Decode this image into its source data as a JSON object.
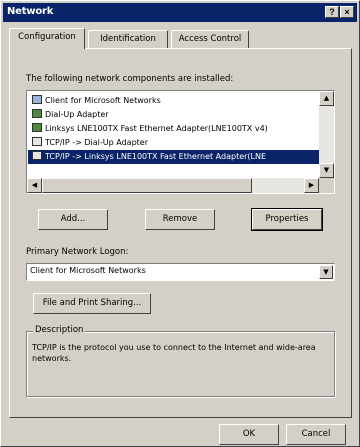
{
  "window": {
    "title": "Network",
    "help_button": "?",
    "close_button": "×"
  },
  "tabs": [
    {
      "label": "Configuration",
      "active": true
    },
    {
      "label": "Identification",
      "active": false
    },
    {
      "label": "Access Control",
      "active": false
    }
  ],
  "components": {
    "label": "The following network components are installed:",
    "items": [
      {
        "label": "Client for Microsoft Networks",
        "icon": "network-client-icon",
        "selected": false
      },
      {
        "label": "Dial-Up Adapter",
        "icon": "network-adapter-icon",
        "selected": false
      },
      {
        "label": "Linksys LNE100TX Fast Ethernet Adapter(LNE100TX v4)",
        "icon": "network-adapter-icon",
        "selected": false
      },
      {
        "label": "TCP/IP -> Dial-Up Adapter",
        "icon": "protocol-icon",
        "selected": false
      },
      {
        "label": "TCP/IP -> Linksys LNE100TX Fast Ethernet Adapter(LNE",
        "icon": "protocol-icon",
        "selected": true
      }
    ]
  },
  "buttons": {
    "add": "Add...",
    "remove": "Remove",
    "properties": "Properties",
    "file_print_sharing": "File and Print Sharing...",
    "ok": "OK",
    "cancel": "Cancel"
  },
  "logon": {
    "label": "Primary Network Logon:",
    "value": "Client for Microsoft Networks"
  },
  "description": {
    "legend": "Description",
    "text": "TCP/IP is the protocol you use to connect to the Internet and wide-area networks."
  },
  "colors": {
    "titlebar": "#0a246a",
    "face": "#d4d0c8",
    "selection": "#0a246a"
  }
}
